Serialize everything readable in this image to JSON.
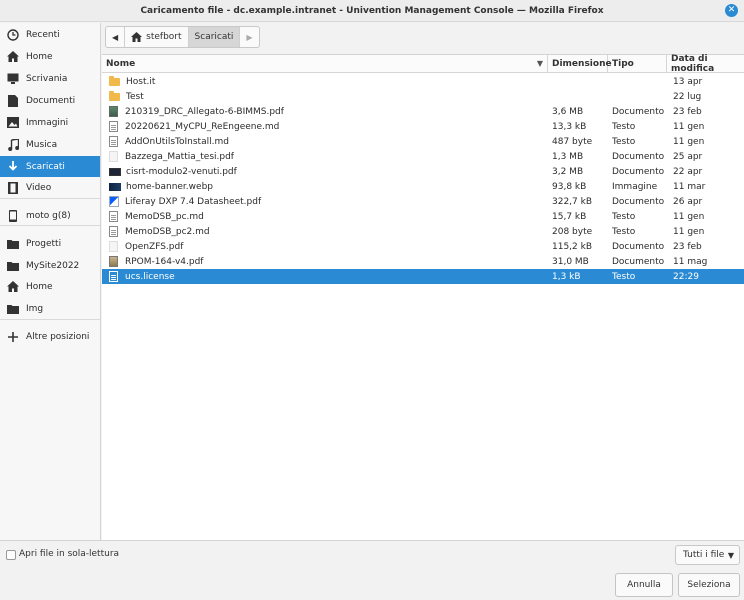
{
  "window": {
    "title": "Caricamento file - dc.example.intranet - Univention Management Console — Mozilla Firefox",
    "close_glyph": "✕"
  },
  "sidebar": {
    "items": [
      {
        "label": "Recenti",
        "icon": "clock-icon"
      },
      {
        "label": "Home",
        "icon": "home-icon"
      },
      {
        "label": "Scrivania",
        "icon": "desktop-icon"
      },
      {
        "label": "Documenti",
        "icon": "document-icon"
      },
      {
        "label": "Immagini",
        "icon": "image-icon"
      },
      {
        "label": "Musica",
        "icon": "music-icon"
      },
      {
        "label": "Scaricati",
        "icon": "download-icon",
        "active": true
      },
      {
        "label": "Video",
        "icon": "video-icon"
      },
      {
        "label": "moto g(8)",
        "icon": "phone-icon"
      },
      {
        "label": "Progetti",
        "icon": "folder-icon"
      },
      {
        "label": "MySite2022",
        "icon": "folder-icon"
      },
      {
        "label": "Home",
        "icon": "home-icon"
      },
      {
        "label": "Img",
        "icon": "folder-icon"
      },
      {
        "label": "Altre posizioni",
        "icon": "plus-icon"
      }
    ],
    "accent": "#2a8bd4"
  },
  "pathbar": {
    "back_glyph": "◀",
    "forward_glyph": "▶",
    "home_label": "stefbort",
    "current_label": "Scaricati"
  },
  "columns": {
    "name": "Nome",
    "size": "Dimensione",
    "type": "Tipo",
    "date": "Data di modifica",
    "sort_glyph": "▼"
  },
  "files": [
    {
      "name": "Host.it",
      "size": "",
      "type": "",
      "date": "13 apr",
      "icon": "folder"
    },
    {
      "name": "Test",
      "size": "",
      "type": "",
      "date": "22 lug",
      "icon": "folder"
    },
    {
      "name": "210319_DRC_Allegato-6-BIMMS.pdf",
      "size": "3,6 MB",
      "type": "Documento",
      "date": "23 feb",
      "icon": "pdfimg"
    },
    {
      "name": "20220621_MyCPU_ReEngeene.md",
      "size": "13,3 kB",
      "type": "Testo",
      "date": "11 gen",
      "icon": "doc"
    },
    {
      "name": "AddOnUtilsToInstall.md",
      "size": "487 byte",
      "type": "Testo",
      "date": "11 gen",
      "icon": "doc"
    },
    {
      "name": "Bazzega_Mattia_tesi.pdf",
      "size": "1,3 MB",
      "type": "Documento",
      "date": "25 apr",
      "icon": "pdfblank"
    },
    {
      "name": "cisrt-modulo2-venuti.pdf",
      "size": "3,2 MB",
      "type": "Documento",
      "date": "22 apr",
      "icon": "pdfdark"
    },
    {
      "name": "home-banner.webp",
      "size": "93,8 kB",
      "type": "Immagine",
      "date": "11 mar",
      "icon": "webp"
    },
    {
      "name": "Liferay DXP 7.4 Datasheet.pdf",
      "size": "322,7 kB",
      "type": "Documento",
      "date": "26 apr",
      "icon": "liferay"
    },
    {
      "name": "MemoDSB_pc.md",
      "size": "15,7 kB",
      "type": "Testo",
      "date": "11 gen",
      "icon": "doc"
    },
    {
      "name": "MemoDSB_pc2.md",
      "size": "208 byte",
      "type": "Testo",
      "date": "11 gen",
      "icon": "doc"
    },
    {
      "name": "OpenZFS.pdf",
      "size": "115,2 kB",
      "type": "Documento",
      "date": "23 feb",
      "icon": "pdfblank"
    },
    {
      "name": "RPOM-164-v4.pdf",
      "size": "31,0 MB",
      "type": "Documento",
      "date": "11 mag",
      "icon": "rpom"
    },
    {
      "name": "ucs.license",
      "size": "1,3 kB",
      "type": "Testo",
      "date": "22:29",
      "icon": "licfile",
      "selected": true
    }
  ],
  "bottom": {
    "readonly_label": "Apri file in sola-lettura",
    "filter_label": "Tutti i file",
    "filter_arrow": "▼",
    "cancel_label": "Annulla",
    "select_label": "Seleziona"
  }
}
